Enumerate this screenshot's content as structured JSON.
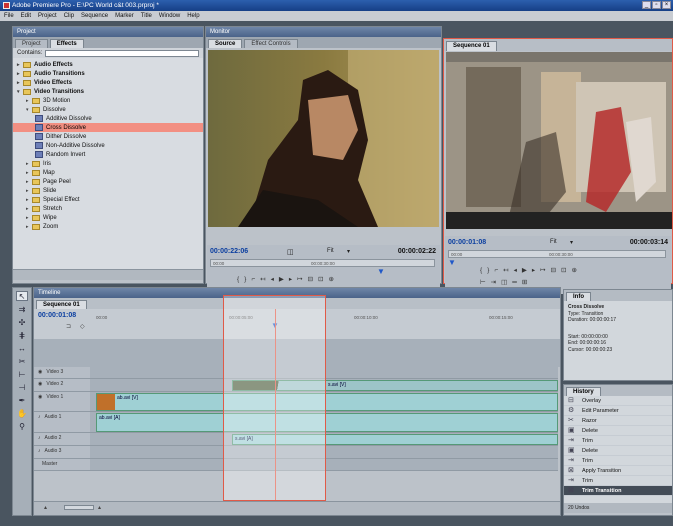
{
  "window": {
    "title": "Adobe Premiere Pro - E:\\PC World c&t 003.prproj *"
  },
  "menu": [
    "File",
    "Edit",
    "Project",
    "Clip",
    "Sequence",
    "Marker",
    "Title",
    "Window",
    "Help"
  ],
  "effects_panel": {
    "header": "Project",
    "tabs": [
      "Project",
      "Effects"
    ],
    "contains_label": "Contains:",
    "tree": [
      {
        "label": "Audio Effects",
        "type": "folder",
        "level": 0,
        "bold": true
      },
      {
        "label": "Audio Transitions",
        "type": "folder",
        "level": 0,
        "bold": true
      },
      {
        "label": "Video Effects",
        "type": "folder",
        "level": 0,
        "bold": true
      },
      {
        "label": "Video Transitions",
        "type": "folder",
        "level": 0,
        "bold": true,
        "open": true
      },
      {
        "label": "3D Motion",
        "type": "folder",
        "level": 1
      },
      {
        "label": "Dissolve",
        "type": "folder",
        "level": 1,
        "open": true
      },
      {
        "label": "Additive Dissolve",
        "type": "fx",
        "level": 2
      },
      {
        "label": "Cross Dissolve",
        "type": "fx",
        "level": 2,
        "selected": true
      },
      {
        "label": "Dither Dissolve",
        "type": "fx",
        "level": 2
      },
      {
        "label": "Non-Additive Dissolve",
        "type": "fx",
        "level": 2
      },
      {
        "label": "Random Invert",
        "type": "fx",
        "level": 2
      },
      {
        "label": "Iris",
        "type": "folder",
        "level": 1
      },
      {
        "label": "Map",
        "type": "folder",
        "level": 1
      },
      {
        "label": "Page Peel",
        "type": "folder",
        "level": 1
      },
      {
        "label": "Slide",
        "type": "folder",
        "level": 1
      },
      {
        "label": "Special Effect",
        "type": "folder",
        "level": 1
      },
      {
        "label": "Stretch",
        "type": "folder",
        "level": 1
      },
      {
        "label": "Wipe",
        "type": "folder",
        "level": 1
      },
      {
        "label": "Zoom",
        "type": "folder",
        "level": 1
      }
    ]
  },
  "source_monitor": {
    "header": "Monitor",
    "tabs": [
      "Source",
      "Effect Controls"
    ],
    "timecode_current": "00:00:22:06",
    "fit_label": "Fit",
    "timecode_duration": "00:00:02:22",
    "ruler": [
      "00:00",
      "00:00:30:00"
    ]
  },
  "program_monitor": {
    "tab": "Sequence 01",
    "timecode_current": "00:00:01:08",
    "fit_label": "Fit",
    "timecode_duration": "00:00:03:14",
    "ruler": [
      "00:00",
      "00:00:30:00"
    ]
  },
  "timeline": {
    "header": "Timeline",
    "tab": "Sequence 01",
    "timecode": "00:00:01:08",
    "ruler": [
      "00:00",
      "00:00:05:00",
      "00:00:10:00",
      "00:00:15:00"
    ],
    "tracks": [
      {
        "name": "Video 3"
      },
      {
        "name": "Video 2",
        "clip": "s.avi [V]"
      },
      {
        "name": "Video 1",
        "clip": "ab.avi [V]"
      },
      {
        "name": "Audio 1",
        "clip": "ab.avi [A]"
      },
      {
        "name": "Audio 2",
        "clip": "s.avi [A]"
      },
      {
        "name": "Audio 3"
      },
      {
        "name": "Master"
      }
    ]
  },
  "info_panel": {
    "tab": "Info",
    "lines": [
      "Cross Dissolve",
      "Type: Transition",
      "Duration: 00:00:00:17",
      "",
      "Start: 00:00:00:00",
      "End: 00:00:00:16",
      "Cursor: 00:00:00:23"
    ]
  },
  "history_panel": {
    "tab": "History",
    "items": [
      "Overlay",
      "Edit Parameter",
      "Razor",
      "Delete",
      "Trim",
      "Delete",
      "Trim",
      "Apply Transition",
      "Trim",
      "Trim Transition"
    ],
    "footer": "20 Undos"
  },
  "colors": {
    "highlight": "#e05a48",
    "selected_effect": "#f28f82",
    "timecode_blue": "#0a3ea0"
  }
}
